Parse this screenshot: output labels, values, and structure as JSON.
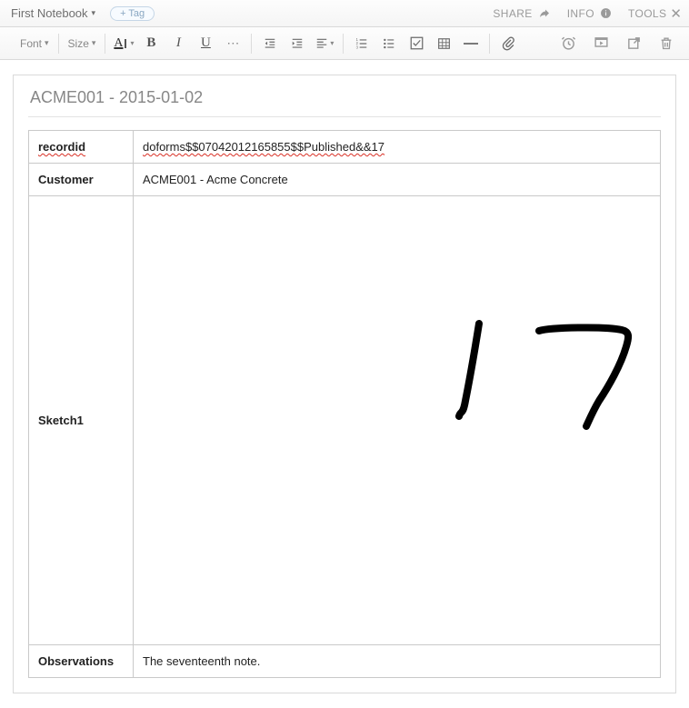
{
  "header": {
    "notebook": "First Notebook",
    "tag_button": "+ Tag",
    "share": "SHARE",
    "info": "INFO",
    "tools": "TOOLS"
  },
  "toolbar": {
    "font_label": "Font",
    "size_label": "Size"
  },
  "note": {
    "title": "ACME001 - 2015-01-02",
    "rows": {
      "recordid": {
        "label": "recordid",
        "value": "doforms$$07042012165855$$Published&&17"
      },
      "customer": {
        "label": "Customer",
        "value": "ACME001 - Acme Concrete"
      },
      "sketch": {
        "label": "Sketch1"
      },
      "observations": {
        "label": "Observations",
        "value": "The seventeenth note."
      }
    }
  }
}
